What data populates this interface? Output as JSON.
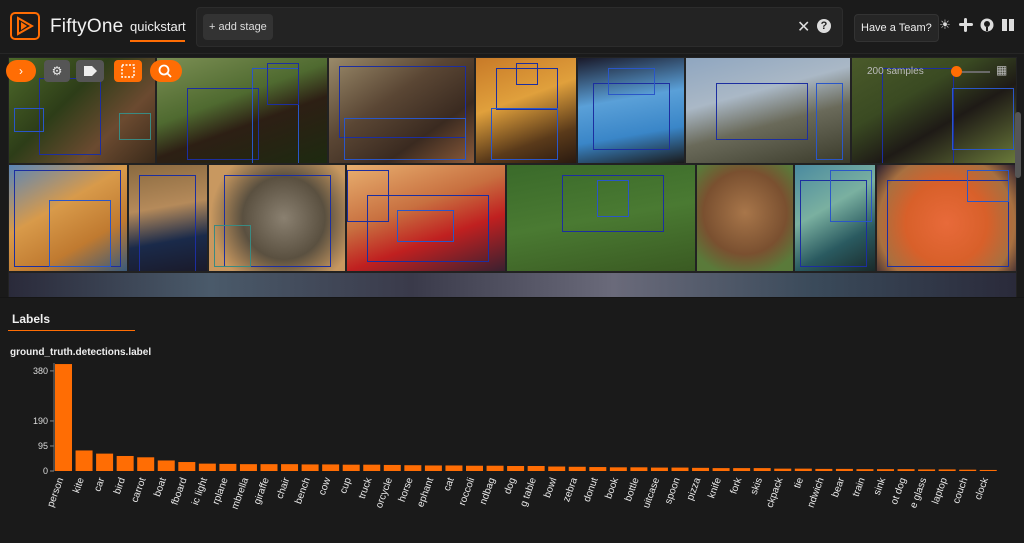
{
  "app": {
    "name": "FiftyOne",
    "dataset": "quickstart",
    "add_stage_label": "+ add stage",
    "close_glyph": "✕",
    "help_glyph": "?",
    "team_button": "Have a Team?",
    "accent": "#ff6d04"
  },
  "grid": {
    "samples_label": "200 samples",
    "controls": [
      "chevron-right-icon",
      "gear-icon",
      "tag-icon",
      "select-icon",
      "search-icon"
    ]
  },
  "labels_panel": {
    "tab": "Labels",
    "field": "ground_truth.detections.label",
    "chart_data": {
      "type": "bar",
      "title": "ground_truth.detections.label",
      "categories": [
        "person",
        "kite",
        "car",
        "bird",
        "carrot",
        "boat",
        "surfboard",
        "traffic light",
        "airplane",
        "umbrella",
        "giraffe",
        "chair",
        "bench",
        "cow",
        "cup",
        "truck",
        "motorcycle",
        "horse",
        "elephant",
        "cat",
        "broccoli",
        "handbag",
        "dog",
        "dining table",
        "bowl",
        "zebra",
        "donut",
        "book",
        "bottle",
        "suitcase",
        "spoon",
        "pizza",
        "knife",
        "fork",
        "skis",
        "backpack",
        "tie",
        "sandwich",
        "bear",
        "train",
        "sink",
        "hot dog",
        "wine glass",
        "laptop",
        "couch",
        "clock"
      ],
      "tick_labels": [
        "person",
        "kite",
        "car",
        "bird",
        "carrot",
        "boat",
        "fboard",
        "ic light",
        "rplane",
        "mbrella",
        "giraffe",
        "chair",
        "bench",
        "cow",
        "cup",
        "truck",
        "orcycle",
        "horse",
        "ephant",
        "cat",
        "roccoli",
        "ndbag",
        "dog",
        "g table",
        "bowl",
        "zebra",
        "donut",
        "book",
        "bottle",
        "uitcase",
        "spoon",
        "pizza",
        "knife",
        "fork",
        "skis",
        "ckpack",
        "tie",
        "ndwich",
        "bear",
        "train",
        "sink",
        "ot dog",
        "e glass",
        "laptop",
        "couch",
        "clock"
      ],
      "values": [
        406,
        78,
        66,
        57,
        52,
        40,
        34,
        28,
        27,
        26,
        26,
        26,
        25,
        25,
        24,
        24,
        23,
        22,
        21,
        21,
        20,
        20,
        19,
        19,
        17,
        16,
        15,
        14,
        14,
        13,
        13,
        12,
        11,
        11,
        11,
        9,
        9,
        8,
        8,
        7,
        7,
        7,
        6,
        6,
        5,
        4
      ],
      "yticks": [
        0,
        95,
        190,
        380
      ],
      "ylim": [
        0,
        410
      ],
      "bar_color": "#ff6d04"
    }
  }
}
